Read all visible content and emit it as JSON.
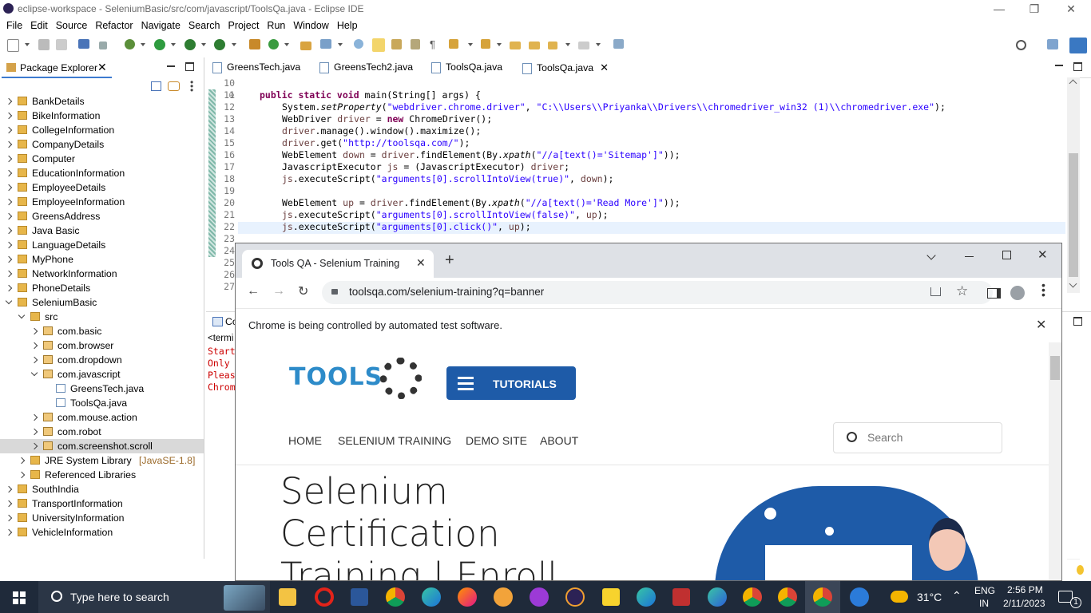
{
  "window": {
    "title": "eclipse-workspace - SeleniumBasic/src/com/javascript/ToolsQa.java - Eclipse IDE"
  },
  "menu": [
    "File",
    "Edit",
    "Source",
    "Refactor",
    "Navigate",
    "Search",
    "Project",
    "Run",
    "Window",
    "Help"
  ],
  "package_explorer": {
    "title": "Package Explorer",
    "items": [
      {
        "label": "BankDetails",
        "level": 0,
        "type": "project",
        "expanded": false
      },
      {
        "label": "BikeInformation",
        "level": 0,
        "type": "project",
        "expanded": false
      },
      {
        "label": "CollegeInformation",
        "level": 0,
        "type": "project",
        "expanded": false
      },
      {
        "label": "CompanyDetails",
        "level": 0,
        "type": "project",
        "expanded": false
      },
      {
        "label": "Computer",
        "level": 0,
        "type": "project",
        "expanded": false
      },
      {
        "label": "EducationInformation",
        "level": 0,
        "type": "project",
        "expanded": false
      },
      {
        "label": "EmployeeDetails",
        "level": 0,
        "type": "project",
        "expanded": false
      },
      {
        "label": "EmployeeInformation",
        "level": 0,
        "type": "project",
        "expanded": false
      },
      {
        "label": "GreensAddress",
        "level": 0,
        "type": "project",
        "expanded": false
      },
      {
        "label": "Java Basic",
        "level": 0,
        "type": "project",
        "expanded": false
      },
      {
        "label": "LanguageDetails",
        "level": 0,
        "type": "project",
        "expanded": false
      },
      {
        "label": "MyPhone",
        "level": 0,
        "type": "project",
        "expanded": false
      },
      {
        "label": "NetworkInformation",
        "level": 0,
        "type": "project",
        "expanded": false
      },
      {
        "label": "PhoneDetails",
        "level": 0,
        "type": "project",
        "expanded": false
      },
      {
        "label": "SeleniumBasic",
        "level": 0,
        "type": "project",
        "expanded": true
      },
      {
        "label": "src",
        "level": 1,
        "type": "src",
        "expanded": true
      },
      {
        "label": "com.basic",
        "level": 2,
        "type": "package",
        "expanded": false
      },
      {
        "label": "com.browser",
        "level": 2,
        "type": "package",
        "expanded": false
      },
      {
        "label": "com.dropdown",
        "level": 2,
        "type": "package",
        "expanded": false
      },
      {
        "label": "com.javascript",
        "level": 2,
        "type": "package",
        "expanded": true
      },
      {
        "label": "GreensTech.java",
        "level": 3,
        "type": "file",
        "expanded": false
      },
      {
        "label": "ToolsQa.java",
        "level": 3,
        "type": "file",
        "expanded": false
      },
      {
        "label": "com.mouse.action",
        "level": 2,
        "type": "package",
        "expanded": false
      },
      {
        "label": "com.robot",
        "level": 2,
        "type": "package",
        "expanded": false
      },
      {
        "label": "com.screenshot.scroll",
        "level": 2,
        "type": "package",
        "expanded": false,
        "selected": true
      },
      {
        "label": "JRE System Library",
        "suffix": "[JavaSE-1.8]",
        "level": 1,
        "type": "library",
        "expanded": false
      },
      {
        "label": "Referenced Libraries",
        "level": 1,
        "type": "library",
        "expanded": false
      },
      {
        "label": "SouthIndia",
        "level": 0,
        "type": "project",
        "expanded": false
      },
      {
        "label": "TransportInformation",
        "level": 0,
        "type": "project",
        "expanded": false
      },
      {
        "label": "UniversityInformation",
        "level": 0,
        "type": "project",
        "expanded": false
      },
      {
        "label": "VehicleInformation",
        "level": 0,
        "type": "project",
        "expanded": false
      }
    ]
  },
  "editor": {
    "tabs": [
      {
        "label": "GreensTech.java",
        "active": false
      },
      {
        "label": "GreensTech2.java",
        "active": false
      },
      {
        "label": "ToolsQa.java",
        "active": false
      },
      {
        "label": "ToolsQa.java",
        "active": true
      }
    ],
    "line_numbers": [
      "10",
      "11",
      "12",
      "13",
      "14",
      "15",
      "16",
      "17",
      "18",
      "19",
      "20",
      "21",
      "22",
      "23",
      "24",
      "25",
      "26",
      "27"
    ],
    "code": {
      "l11_kw": "public static void",
      "l11_rest": " main(String[] args) {",
      "l12_a": "System.",
      "l12_m": "setProperty",
      "l12_b": "(",
      "l12_s1": "\"webdriver.chrome.driver\"",
      "l12_c": ", ",
      "l12_s2": "\"C:\\\\Users\\\\Priyanka\\\\Drivers\\\\chromedriver_win32 (1)\\\\chromedriver.exe\"",
      "l12_d": ");",
      "l13_a": "WebDriver ",
      "l13_v": "driver",
      "l13_b": " = ",
      "l13_kw": "new",
      "l13_c": " ChromeDriver();",
      "l14_v": "driver",
      "l14_a": ".manage().window().maximize();",
      "l15_v": "driver",
      "l15_a": ".get(",
      "l15_s": "\"http://toolsqa.com/\"",
      "l15_b": ");",
      "l16_a": "WebElement ",
      "l16_v": "down",
      "l16_b": " = ",
      "l16_v2": "driver",
      "l16_c": ".findElement(By.",
      "l16_m": "xpath",
      "l16_d": "(",
      "l16_s": "\"//a[text()='Sitemap']\"",
      "l16_e": "));",
      "l17_a": "JavascriptExecutor ",
      "l17_v": "js",
      "l17_b": " = (JavascriptExecutor) ",
      "l17_v2": "driver",
      "l17_c": ";",
      "l18_v": "js",
      "l18_a": ".executeScript(",
      "l18_s": "\"arguments[0].scrollIntoView(true)\"",
      "l18_b": ", ",
      "l18_v2": "down",
      "l18_c": ");",
      "l20_a": "WebElement ",
      "l20_v": "up",
      "l20_b": " = ",
      "l20_v2": "driver",
      "l20_c": ".findElement(By.",
      "l20_m": "xpath",
      "l20_d": "(",
      "l20_s": "\"//a[text()='Read More']\"",
      "l20_e": "));",
      "l21_v": "js",
      "l21_a": ".executeScript(",
      "l21_s": "\"arguments[0].scrollIntoView(false)\"",
      "l21_b": ", ",
      "l21_v2": "up",
      "l21_c": ");",
      "l22_v": "js",
      "l22_a": ".executeScript(",
      "l22_s": "\"arguments[0].click()\"",
      "l22_b": ", ",
      "l22_v2": "up",
      "l22_c": ");"
    }
  },
  "console": {
    "tab_label": "Co",
    "terminated": "<termi",
    "lines": [
      "Start",
      "Only",
      "Pleas",
      "Chrom"
    ]
  },
  "chrome": {
    "tab_title": "Tools QA - Selenium Training",
    "url": "toolsqa.com/selenium-training?q=banner",
    "info_bar": "Chrome is being controlled by automated test software.",
    "site": {
      "logo_text": "TOOLS",
      "tutorials_button": "TUTORIALS",
      "nav": [
        "HOME",
        "SELENIUM TRAINING",
        "DEMO SITE",
        "ABOUT"
      ],
      "search_placeholder": "Search",
      "hero_lines": [
        "Selenium",
        "Certification",
        "Training | Enroll"
      ],
      "brand_blue": "#1e5ba8"
    }
  },
  "taskbar": {
    "search_placeholder": "Type here to search",
    "weather": "31°C",
    "lang_top": "ENG",
    "lang_bottom": "IN",
    "time": "2:56 PM",
    "date": "2/11/2023",
    "notification_count": "1"
  }
}
